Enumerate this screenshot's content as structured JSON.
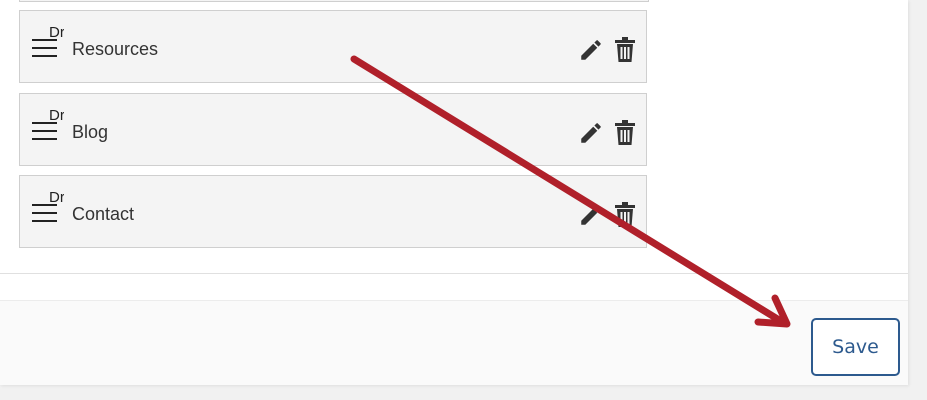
{
  "menu_items": [
    {
      "label": "Resources",
      "drag_text": "Dr",
      "icon_edit": "pencil-icon",
      "icon_delete": "trash-icon"
    },
    {
      "label": "Blog",
      "drag_text": "Dr",
      "icon_edit": "pencil-icon",
      "icon_delete": "trash-icon"
    },
    {
      "label": "Contact",
      "drag_text": "Dr",
      "icon_edit": "pencil-icon",
      "icon_delete": "trash-icon"
    }
  ],
  "footer": {
    "save_label": "Save"
  },
  "colors": {
    "accent": "#2d5a8e",
    "annotation_arrow": "#b0202a",
    "item_background": "#f4f4f4"
  }
}
